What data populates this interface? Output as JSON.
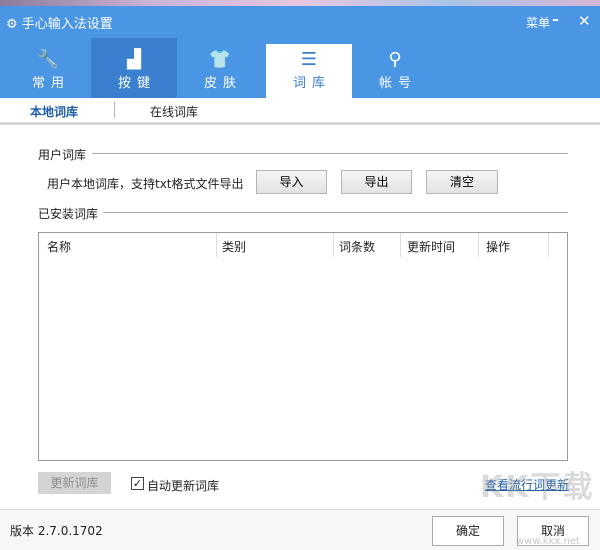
{
  "window": {
    "title": "手心输入法设置",
    "menu": "菜单",
    "minimize": "–",
    "close": "✕"
  },
  "tabs": [
    {
      "label": "常用",
      "icon": "wrench-icon",
      "glyph": "🔧"
    },
    {
      "label": "按键",
      "icon": "key-icon",
      "glyph": "▟"
    },
    {
      "label": "皮肤",
      "icon": "shirt-icon",
      "glyph": "👕"
    },
    {
      "label": "词库",
      "icon": "document-icon",
      "glyph": "☰"
    },
    {
      "label": "帐号",
      "icon": "user-icon",
      "glyph": "⚲"
    }
  ],
  "active_tab": "词库",
  "subtabs": [
    "本地词库",
    "在线词库"
  ],
  "user_dict": {
    "heading": "用户词库",
    "desc": "用户本地词库，支持txt格式文件导出",
    "import": "导入",
    "export": "导出",
    "clear": "清空"
  },
  "installed": {
    "heading": "已安装词库",
    "columns": [
      "名称",
      "类别",
      "词条数",
      "更新时间",
      "操作"
    ],
    "rows": []
  },
  "bottom": {
    "update_button": "更新词库",
    "auto_update_label": "自动更新词库",
    "auto_update_checked": true,
    "link": "查看流行词更新"
  },
  "footer": {
    "version": "版本 2.7.0.1702",
    "ok": "确定",
    "cancel": "取消"
  },
  "watermark": {
    "text": "KK下载",
    "url": "www.kkx.net"
  }
}
